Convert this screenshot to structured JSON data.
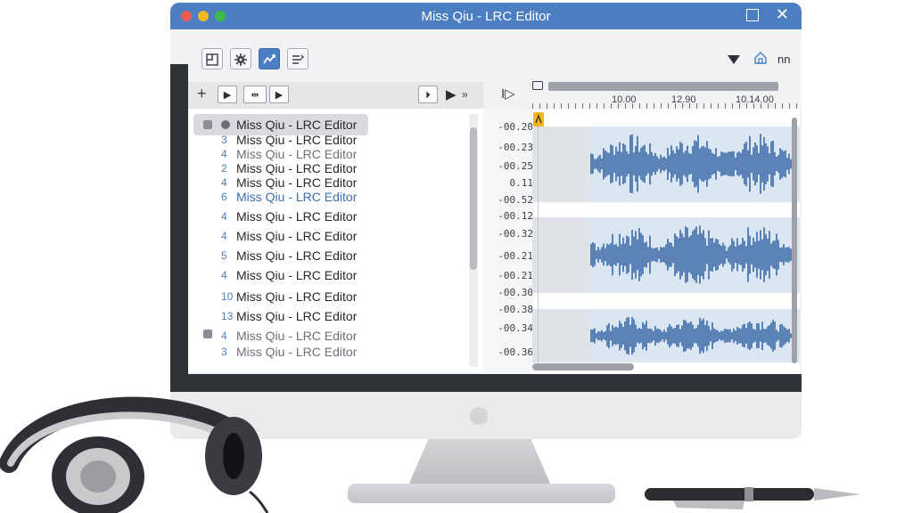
{
  "window": {
    "title": "Miss Qiu - LRC Editor"
  },
  "toolbar": {
    "right_text": "nn"
  },
  "list_toolbar": {
    "plus": "+",
    "right_label": "»"
  },
  "lyrics": [
    {
      "num": "",
      "text": "Miss Qiu - LRC Editor",
      "style": "sel"
    },
    {
      "num": "3",
      "text": "Miss Qiu - LRC Editor",
      "style": ""
    },
    {
      "num": "4",
      "text": "Miss Qiu - LRC Editor",
      "style": "faded"
    },
    {
      "num": "2",
      "text": "Miss Qiu - LRC Editor",
      "style": ""
    },
    {
      "num": "4",
      "text": "Miss Qiu - LRC Editor",
      "style": ""
    },
    {
      "num": "6",
      "text": "Miss Qiu - LRC Editor",
      "style": "blue"
    },
    {
      "num": "4",
      "text": "Miss Qiu - LRC Editor",
      "style": ""
    },
    {
      "num": "4",
      "text": "Miss Qiu - LRC Editor",
      "style": ""
    },
    {
      "num": "5",
      "text": "Miss Qiu - LRC Editor",
      "style": ""
    },
    {
      "num": "4",
      "text": "Miss Qiu - LRC Editor",
      "style": ""
    },
    {
      "num": "10",
      "text": "Miss Qiu - LRC Editor",
      "style": ""
    },
    {
      "num": "13",
      "text": "Miss Qiu - LRC Editor",
      "style": ""
    },
    {
      "num": "4",
      "text": "Miss Qiu - LRC Editor",
      "style": "faded"
    },
    {
      "num": "3",
      "text": "Miss Qiu - LRC Editor",
      "style": "faded"
    }
  ],
  "timecodes": [
    "-00.20",
    "-00.23",
    "-00.25",
    "0.11",
    "-00.52",
    "-00.12",
    "-00.32",
    "-00.21",
    "-00.21",
    "-00.30",
    "-00.38",
    "-00.34",
    "-00.36"
  ],
  "ruler": {
    "labels": [
      "10.00",
      "12.90",
      "10.14.00"
    ]
  },
  "colors": {
    "titlebar": "#4b7fc1",
    "waveform": "#3b6aa6",
    "playhead": "#f0b81e"
  }
}
